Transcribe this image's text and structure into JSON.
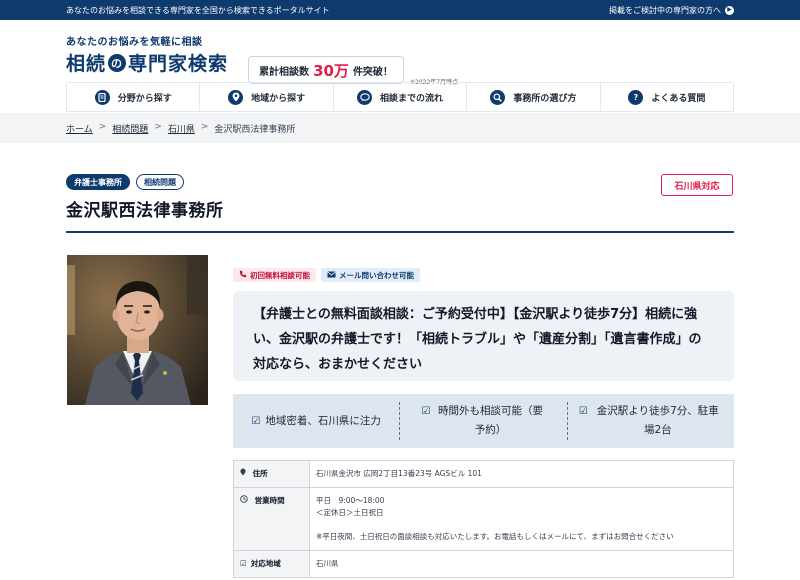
{
  "topbar": {
    "left": "あなたのお悩みを相談できる専門家を全国から検索できるポータルサイト",
    "right": "掲載をご検討中の専門家の方へ"
  },
  "header": {
    "logo_sub": "あなたのお悩みを気軽に相談",
    "logo_part1": "相続",
    "logo_no": "の",
    "logo_part2": "専門家検索",
    "counter_prefix": "累計相談数",
    "counter_value": "30万",
    "counter_suffix": "件突破！",
    "counter_note": "※2022年7月時点"
  },
  "nav": {
    "items": [
      {
        "label": "分野から探す",
        "icon": "document-icon"
      },
      {
        "label": "地域から探す",
        "icon": "map-pin-icon"
      },
      {
        "label": "相談までの流れ",
        "icon": "chat-icon"
      },
      {
        "label": "事務所の選び方",
        "icon": "search-icon"
      },
      {
        "label": "よくある質問",
        "icon": "question-icon"
      }
    ]
  },
  "breadcrumb": {
    "items": [
      "ホーム",
      "相続問題",
      "石川県",
      "金沢駅西法律事務所"
    ],
    "sep": ">"
  },
  "office": {
    "tag_type": "弁護士事務所",
    "tag_field": "相続問題",
    "pref_badge": "石川県対応",
    "name": "金沢駅西法律事務所",
    "chip_free": "初回無料相談可能",
    "chip_mail": "メール問い合わせ可能",
    "catch": "【弁護士との無料面談相談：ご予約受付中】【金沢駅より徒歩7分】相続に強い、金沢駅の弁護士です！「相続トラブル」や「遺産分割」「遺言書作成」の対応なら、おまかせください",
    "points": [
      "地域密着、石川県に注力",
      "時間外も相談可能（要予約）",
      "金沢駅より徒歩7分、駐車場2台"
    ]
  },
  "info": {
    "address_label": "住所",
    "address": "石川県金沢市 広岡2丁目13番23号 AGSビル 101",
    "hours_label": "営業時間",
    "hours_line1": "平日　9:00～18:00",
    "hours_line2": "＜定休日＞土日祝日",
    "hours_note": "※平日夜間、土日祝日の面談相談も対応いたします。お電話もしくはメールにて、まずはお問合せください",
    "area_label": "対応地域",
    "area": "石川県"
  }
}
